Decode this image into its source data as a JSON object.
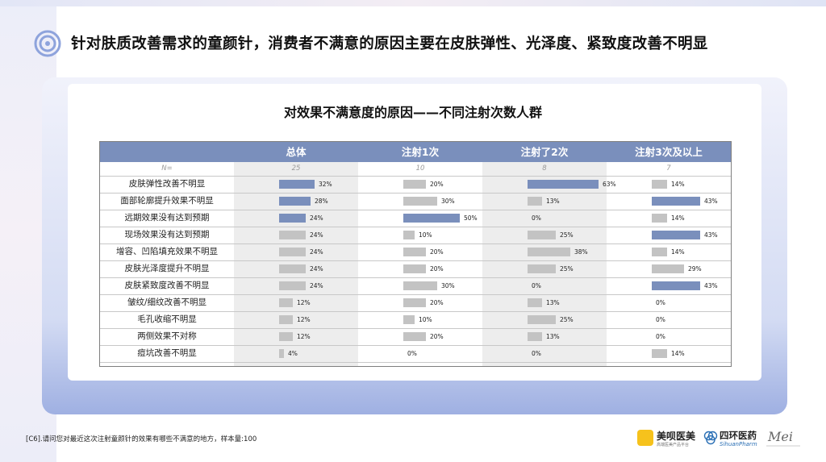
{
  "page_title": "针对肤质改善需求的童颜针，消费者不满意的原因主要在皮肤弹性、光泽度、紧致度改善不明显",
  "footnote": "[C6].请问您对最近这次注射童颜针的效果有哪些不满意的地方，样本量:100",
  "logos": {
    "meipai_name": "美呗医美",
    "meipai_sub": "高端医美产品平台",
    "sihuan_name": "四环医药",
    "sihuan_sub": "SihuanPharm",
    "mei_mark": "Mei"
  },
  "colors": {
    "header": "#7a8fbc",
    "bar_highlight": "#7a8fbc",
    "bar_normal": "#c3c3c3"
  },
  "chart_data": {
    "type": "table",
    "title": "对效果不满意度的原因——不同注射次数人群",
    "n_label": "N=",
    "unit": "%",
    "columns": [
      {
        "name": "总体",
        "n": "25"
      },
      {
        "name": "注射1次",
        "n": "10"
      },
      {
        "name": "注射了2次",
        "n": "8"
      },
      {
        "name": "注射3次及以上",
        "n": "7"
      }
    ],
    "rows": [
      {
        "label": "皮肤弹性改善不明显",
        "values": [
          32,
          20,
          63,
          14
        ],
        "highlight": [
          true,
          false,
          true,
          false
        ]
      },
      {
        "label": "面部轮廓提升效果不明显",
        "values": [
          28,
          30,
          13,
          43
        ],
        "highlight": [
          true,
          false,
          false,
          true
        ]
      },
      {
        "label": "远期效果没有达到预期",
        "values": [
          24,
          50,
          0,
          14
        ],
        "highlight": [
          true,
          true,
          false,
          false
        ]
      },
      {
        "label": "现场效果没有达到预期",
        "values": [
          24,
          10,
          25,
          43
        ],
        "highlight": [
          false,
          false,
          false,
          true
        ]
      },
      {
        "label": "增容、凹陷填充效果不明显",
        "values": [
          24,
          20,
          38,
          14
        ],
        "highlight": [
          false,
          false,
          false,
          false
        ]
      },
      {
        "label": "皮肤光泽度提升不明显",
        "values": [
          24,
          20,
          25,
          29
        ],
        "highlight": [
          false,
          false,
          false,
          false
        ]
      },
      {
        "label": "皮肤紧致度改善不明显",
        "values": [
          24,
          30,
          0,
          43
        ],
        "highlight": [
          false,
          false,
          false,
          true
        ]
      },
      {
        "label": "皱纹/细纹改善不明显",
        "values": [
          12,
          20,
          13,
          0
        ],
        "highlight": [
          false,
          false,
          false,
          false
        ]
      },
      {
        "label": "毛孔收缩不明显",
        "values": [
          12,
          10,
          25,
          0
        ],
        "highlight": [
          false,
          false,
          false,
          false
        ]
      },
      {
        "label": "两侧效果不对称",
        "values": [
          12,
          20,
          13,
          0
        ],
        "highlight": [
          false,
          false,
          false,
          false
        ]
      },
      {
        "label": "痘坑改善不明显",
        "values": [
          4,
          0,
          0,
          14
        ],
        "highlight": [
          false,
          false,
          false,
          false
        ]
      }
    ]
  }
}
